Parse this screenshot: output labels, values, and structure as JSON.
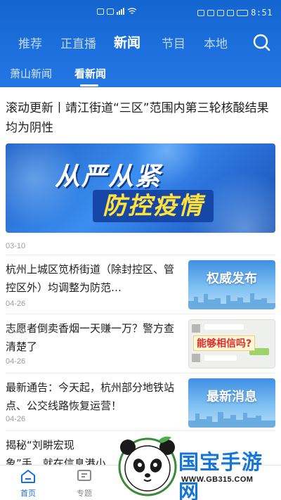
{
  "status_bar": {
    "time": "8:51"
  },
  "top_nav": {
    "tabs": [
      {
        "label": "推荐"
      },
      {
        "label": "正直播"
      },
      {
        "label": "新闻"
      },
      {
        "label": "节目"
      },
      {
        "label": "本地"
      }
    ],
    "active_tab": "新闻",
    "search_icon": "search-icon"
  },
  "sub_nav": {
    "tabs": [
      {
        "label": "萧山新闻"
      },
      {
        "label": "看新闻"
      }
    ],
    "active_tab": "看新闻"
  },
  "feed": {
    "headline": {
      "title": "滚动更新丨靖江街道“三区”范围内第三轮核酸结果均为阴性",
      "banner_line1": "从严从紧",
      "banner_line2": "防控疫情",
      "date": "03-10"
    },
    "items": [
      {
        "title": "杭州上城区笕桥街道（除封控区、管控区外）均调整为防范…",
        "date": "04-26",
        "thumb_text": "权威发布"
      },
      {
        "title": "志愿者倒卖香烟一天赚一万？警方查清楚了",
        "date": "04-26",
        "thumb_text": "能够相信吗?"
      },
      {
        "title": "最新通告：今天起，杭州部分地铁站点、公交线路恢复运营！",
        "date": "04-26",
        "thumb_text": "最新消息"
      },
      {
        "title": "揭秘“刘畊宏现象”手，就在信息港小",
        "date": "",
        "thumb_text": ""
      }
    ]
  },
  "bottom_nav": {
    "items": [
      {
        "label": "首页",
        "icon": "home-icon",
        "active": true
      },
      {
        "label": "专题",
        "icon": "topic-icon",
        "active": false
      }
    ]
  },
  "watermark": {
    "title": "国宝手游网",
    "url": "WWW.GB315.COM"
  },
  "colors": {
    "brand_blue": "#1c6fdc",
    "active_nav": "#1a6ee0",
    "text": "#1e1e1e",
    "date_gray": "#9a9a9a"
  }
}
